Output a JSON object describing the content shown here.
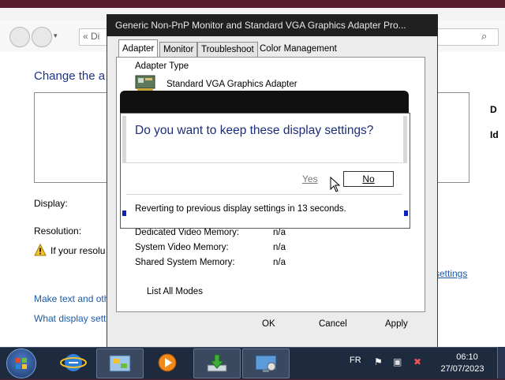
{
  "control_panel": {
    "address_text": "« Di",
    "heading": "Change the a",
    "display_label": "Display:",
    "resolution_label": "Resolution:",
    "warning_text": "If your resolu",
    "settings_link": "settings",
    "link_text_size": "Make text and oth",
    "link_display_settings": "What display sett",
    "right_label_1": "D",
    "right_label_2": "Id"
  },
  "properties": {
    "title": "Generic Non-PnP Monitor and Standard VGA Graphics Adapter Pro...",
    "tabs": [
      "Adapter",
      "Monitor",
      "Troubleshoot",
      "Color Management"
    ],
    "adapter_type_label": "Adapter Type",
    "adapter_name": "Standard VGA Graphics Adapter",
    "memory": [
      {
        "label": "Dedicated Video Memory:",
        "value": "n/a"
      },
      {
        "label": "System Video Memory:",
        "value": "n/a"
      },
      {
        "label": "Shared System Memory:",
        "value": "n/a"
      }
    ],
    "list_modes": "List All Modes",
    "ok": "OK",
    "cancel": "Cancel",
    "apply": "Apply"
  },
  "confirm": {
    "question": "Do you want to keep these display settings?",
    "yes": "Yes",
    "no": "No",
    "revert_text": "Reverting to previous display settings in 13 seconds."
  },
  "taskbar": {
    "language": "FR",
    "time": "06:10",
    "date": "27/07/2023",
    "items": [
      "internet-explorer-icon",
      "control-panel-icon",
      "media-player-icon",
      "download-icon",
      "display-settings-icon"
    ]
  },
  "colors": {
    "accent_blue": "#1e3287",
    "link_blue": "#1e5aa6",
    "taskbar": "#1e2a3d"
  }
}
